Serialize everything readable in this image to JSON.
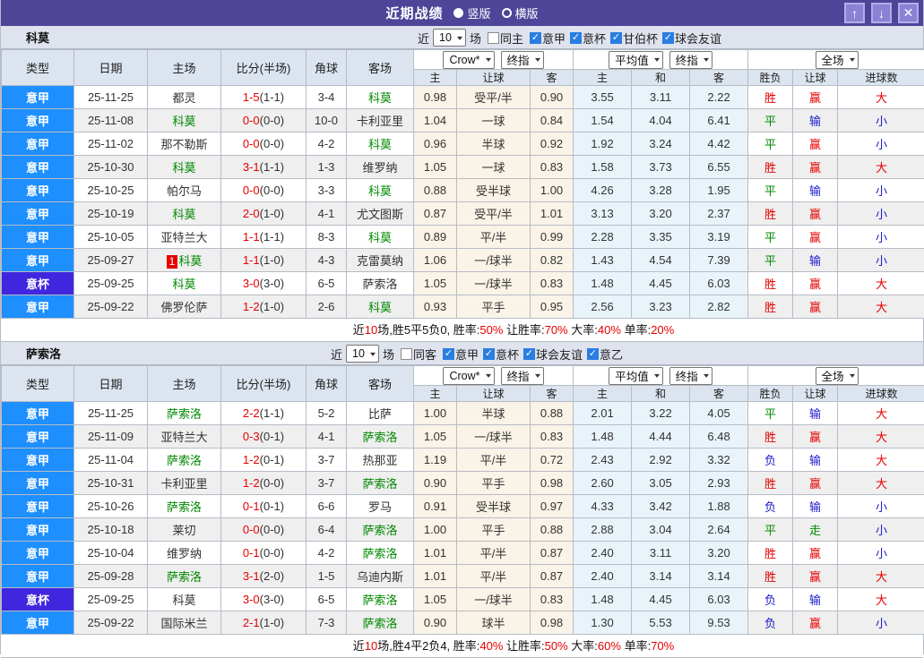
{
  "titlebar": {
    "title": "近期战绩",
    "radios": [
      {
        "label": "竖版",
        "selected": "true"
      },
      {
        "label": "横版",
        "selected": "false"
      }
    ],
    "up_icon": "↑",
    "down_icon": "↓",
    "close_icon": "✕"
  },
  "table_labels": {
    "type": "类型",
    "date": "日期",
    "home": "主场",
    "score": "比分(半场)",
    "corner": "角球",
    "away": "客场",
    "ah_home": "主",
    "ah_line": "让球",
    "ah_away": "客",
    "eu_home": "主",
    "eu_draw": "和",
    "eu_away": "客",
    "result": "胜负",
    "r_handicap": "让球",
    "r_goals": "进球数"
  },
  "dropdowns": {
    "bookmaker": "Crow*",
    "final1": "终指",
    "average": "平均值",
    "final2": "终指",
    "scope": "全场"
  },
  "colors": {
    "league_blue": "#1e8fff",
    "cup_purple": "#4126df",
    "win_red": "#e60000",
    "draw_green": "#008800",
    "lose_blue": "#1a1acd",
    "title_bg": "#4e4599",
    "focus_team_green": "#008800",
    "checkbox_blue": "#2a7de1"
  },
  "sections": [
    {
      "team": "科莫",
      "filters": {
        "near": "近",
        "count": "10",
        "games": "场",
        "same": "同主",
        "leagues": [
          "意甲",
          "意杯",
          "甘伯杯",
          "球会友谊"
        ]
      },
      "rows": [
        {
          "lg": {
            "t": "意甲",
            "c": "jia"
          },
          "date": "25-11-25",
          "hm": {
            "n": "都灵",
            "f": "false",
            "bd": ""
          },
          "sc": {
            "m": "1-5",
            "h": "(1-1)"
          },
          "cr": "3-4",
          "aw": {
            "n": "科莫",
            "f": "true"
          },
          "ah": [
            "0.98",
            "受平/半",
            "0.90"
          ],
          "eu": [
            "3.55",
            "3.11",
            "2.22"
          ],
          "rs": [
            {
              "t": "胜",
              "c": "r"
            },
            {
              "t": "赢",
              "c": "r"
            },
            {
              "t": "大",
              "c": "r"
            }
          ]
        },
        {
          "lg": {
            "t": "意甲",
            "c": "jia"
          },
          "date": "25-11-08",
          "hm": {
            "n": "科莫",
            "f": "true",
            "bd": ""
          },
          "sc": {
            "m": "0-0",
            "h": "(0-0)"
          },
          "cr": "10-0",
          "aw": {
            "n": "卡利亚里",
            "f": "false"
          },
          "ah": [
            "1.04",
            "一球",
            "0.84"
          ],
          "eu": [
            "1.54",
            "4.04",
            "6.41"
          ],
          "rs": [
            {
              "t": "平",
              "c": "g"
            },
            {
              "t": "输",
              "c": "b"
            },
            {
              "t": "小",
              "c": "b"
            }
          ]
        },
        {
          "lg": {
            "t": "意甲",
            "c": "jia"
          },
          "date": "25-11-02",
          "hm": {
            "n": "那不勒斯",
            "f": "false",
            "bd": ""
          },
          "sc": {
            "m": "0-0",
            "h": "(0-0)"
          },
          "cr": "4-2",
          "aw": {
            "n": "科莫",
            "f": "true"
          },
          "ah": [
            "0.96",
            "半球",
            "0.92"
          ],
          "eu": [
            "1.92",
            "3.24",
            "4.42"
          ],
          "rs": [
            {
              "t": "平",
              "c": "g"
            },
            {
              "t": "赢",
              "c": "r"
            },
            {
              "t": "小",
              "c": "b"
            }
          ]
        },
        {
          "lg": {
            "t": "意甲",
            "c": "jia"
          },
          "date": "25-10-30",
          "hm": {
            "n": "科莫",
            "f": "true",
            "bd": ""
          },
          "sc": {
            "m": "3-1",
            "h": "(1-1)"
          },
          "cr": "1-3",
          "aw": {
            "n": "维罗纳",
            "f": "false"
          },
          "ah": [
            "1.05",
            "一球",
            "0.83"
          ],
          "eu": [
            "1.58",
            "3.73",
            "6.55"
          ],
          "rs": [
            {
              "t": "胜",
              "c": "r"
            },
            {
              "t": "赢",
              "c": "r"
            },
            {
              "t": "大",
              "c": "r"
            }
          ]
        },
        {
          "lg": {
            "t": "意甲",
            "c": "jia"
          },
          "date": "25-10-25",
          "hm": {
            "n": "帕尔马",
            "f": "false",
            "bd": ""
          },
          "sc": {
            "m": "0-0",
            "h": "(0-0)"
          },
          "cr": "3-3",
          "aw": {
            "n": "科莫",
            "f": "true"
          },
          "ah": [
            "0.88",
            "受半球",
            "1.00"
          ],
          "eu": [
            "4.26",
            "3.28",
            "1.95"
          ],
          "rs": [
            {
              "t": "平",
              "c": "g"
            },
            {
              "t": "输",
              "c": "b"
            },
            {
              "t": "小",
              "c": "b"
            }
          ]
        },
        {
          "lg": {
            "t": "意甲",
            "c": "jia"
          },
          "date": "25-10-19",
          "hm": {
            "n": "科莫",
            "f": "true",
            "bd": ""
          },
          "sc": {
            "m": "2-0",
            "h": "(1-0)"
          },
          "cr": "4-1",
          "aw": {
            "n": "尤文图斯",
            "f": "false"
          },
          "ah": [
            "0.87",
            "受平/半",
            "1.01"
          ],
          "eu": [
            "3.13",
            "3.20",
            "2.37"
          ],
          "rs": [
            {
              "t": "胜",
              "c": "r"
            },
            {
              "t": "赢",
              "c": "r"
            },
            {
              "t": "小",
              "c": "b"
            }
          ]
        },
        {
          "lg": {
            "t": "意甲",
            "c": "jia"
          },
          "date": "25-10-05",
          "hm": {
            "n": "亚特兰大",
            "f": "false",
            "bd": ""
          },
          "sc": {
            "m": "1-1",
            "h": "(1-1)"
          },
          "cr": "8-3",
          "aw": {
            "n": "科莫",
            "f": "true"
          },
          "ah": [
            "0.89",
            "平/半",
            "0.99"
          ],
          "eu": [
            "2.28",
            "3.35",
            "3.19"
          ],
          "rs": [
            {
              "t": "平",
              "c": "g"
            },
            {
              "t": "赢",
              "c": "r"
            },
            {
              "t": "小",
              "c": "b"
            }
          ]
        },
        {
          "lg": {
            "t": "意甲",
            "c": "jia"
          },
          "date": "25-09-27",
          "hm": {
            "n": "科莫",
            "f": "true",
            "bd": "1"
          },
          "sc": {
            "m": "1-1",
            "h": "(1-0)"
          },
          "cr": "4-3",
          "aw": {
            "n": "克雷莫纳",
            "f": "false"
          },
          "ah": [
            "1.06",
            "一/球半",
            "0.82"
          ],
          "eu": [
            "1.43",
            "4.54",
            "7.39"
          ],
          "rs": [
            {
              "t": "平",
              "c": "g"
            },
            {
              "t": "输",
              "c": "b"
            },
            {
              "t": "小",
              "c": "b"
            }
          ]
        },
        {
          "lg": {
            "t": "意杯",
            "c": "bei"
          },
          "date": "25-09-25",
          "hm": {
            "n": "科莫",
            "f": "true",
            "bd": ""
          },
          "sc": {
            "m": "3-0",
            "h": "(3-0)"
          },
          "cr": "6-5",
          "aw": {
            "n": "萨索洛",
            "f": "false"
          },
          "ah": [
            "1.05",
            "一/球半",
            "0.83"
          ],
          "eu": [
            "1.48",
            "4.45",
            "6.03"
          ],
          "rs": [
            {
              "t": "胜",
              "c": "r"
            },
            {
              "t": "赢",
              "c": "r"
            },
            {
              "t": "大",
              "c": "r"
            }
          ]
        },
        {
          "lg": {
            "t": "意甲",
            "c": "jia"
          },
          "date": "25-09-22",
          "hm": {
            "n": "佛罗伦萨",
            "f": "false",
            "bd": ""
          },
          "sc": {
            "m": "1-2",
            "h": "(1-0)"
          },
          "cr": "2-6",
          "aw": {
            "n": "科莫",
            "f": "true"
          },
          "ah": [
            "0.93",
            "平手",
            "0.95"
          ],
          "eu": [
            "2.56",
            "3.23",
            "2.82"
          ],
          "rs": [
            {
              "t": "胜",
              "c": "r"
            },
            {
              "t": "赢",
              "c": "r"
            },
            {
              "t": "大",
              "c": "r"
            }
          ]
        }
      ],
      "summary": [
        {
          "t": "近",
          "c": "k"
        },
        {
          "t": "10",
          "c": "r"
        },
        {
          "t": "场,胜5平5负0, 胜率:",
          "c": "k"
        },
        {
          "t": "50%",
          "c": "r"
        },
        {
          "t": " 让胜率:",
          "c": "k"
        },
        {
          "t": "70%",
          "c": "r"
        },
        {
          "t": " 大率:",
          "c": "k"
        },
        {
          "t": "40%",
          "c": "r"
        },
        {
          "t": " 单率:",
          "c": "k"
        },
        {
          "t": "20%",
          "c": "r"
        }
      ]
    },
    {
      "team": "萨索洛",
      "filters": {
        "near": "近",
        "count": "10",
        "games": "场",
        "same": "同客",
        "leagues": [
          "意甲",
          "意杯",
          "球会友谊",
          "意乙"
        ]
      },
      "rows": [
        {
          "lg": {
            "t": "意甲",
            "c": "jia"
          },
          "date": "25-11-25",
          "hm": {
            "n": "萨索洛",
            "f": "true",
            "bd": ""
          },
          "sc": {
            "m": "2-2",
            "h": "(1-1)"
          },
          "cr": "5-2",
          "aw": {
            "n": "比萨",
            "f": "false"
          },
          "ah": [
            "1.00",
            "半球",
            "0.88"
          ],
          "eu": [
            "2.01",
            "3.22",
            "4.05"
          ],
          "rs": [
            {
              "t": "平",
              "c": "g"
            },
            {
              "t": "输",
              "c": "b"
            },
            {
              "t": "大",
              "c": "r"
            }
          ]
        },
        {
          "lg": {
            "t": "意甲",
            "c": "jia"
          },
          "date": "25-11-09",
          "hm": {
            "n": "亚特兰大",
            "f": "false",
            "bd": ""
          },
          "sc": {
            "m": "0-3",
            "h": "(0-1)"
          },
          "cr": "4-1",
          "aw": {
            "n": "萨索洛",
            "f": "true"
          },
          "ah": [
            "1.05",
            "一/球半",
            "0.83"
          ],
          "eu": [
            "1.48",
            "4.44",
            "6.48"
          ],
          "rs": [
            {
              "t": "胜",
              "c": "r"
            },
            {
              "t": "赢",
              "c": "r"
            },
            {
              "t": "大",
              "c": "r"
            }
          ]
        },
        {
          "lg": {
            "t": "意甲",
            "c": "jia"
          },
          "date": "25-11-04",
          "hm": {
            "n": "萨索洛",
            "f": "true",
            "bd": ""
          },
          "sc": {
            "m": "1-2",
            "h": "(0-1)"
          },
          "cr": "3-7",
          "aw": {
            "n": "热那亚",
            "f": "false"
          },
          "ah": [
            "1.19",
            "平/半",
            "0.72"
          ],
          "eu": [
            "2.43",
            "2.92",
            "3.32"
          ],
          "rs": [
            {
              "t": "负",
              "c": "b"
            },
            {
              "t": "输",
              "c": "b"
            },
            {
              "t": "大",
              "c": "r"
            }
          ]
        },
        {
          "lg": {
            "t": "意甲",
            "c": "jia"
          },
          "date": "25-10-31",
          "hm": {
            "n": "卡利亚里",
            "f": "false",
            "bd": ""
          },
          "sc": {
            "m": "1-2",
            "h": "(0-0)"
          },
          "cr": "3-7",
          "aw": {
            "n": "萨索洛",
            "f": "true"
          },
          "ah": [
            "0.90",
            "平手",
            "0.98"
          ],
          "eu": [
            "2.60",
            "3.05",
            "2.93"
          ],
          "rs": [
            {
              "t": "胜",
              "c": "r"
            },
            {
              "t": "赢",
              "c": "r"
            },
            {
              "t": "大",
              "c": "r"
            }
          ]
        },
        {
          "lg": {
            "t": "意甲",
            "c": "jia"
          },
          "date": "25-10-26",
          "hm": {
            "n": "萨索洛",
            "f": "true",
            "bd": ""
          },
          "sc": {
            "m": "0-1",
            "h": "(0-1)"
          },
          "cr": "6-6",
          "aw": {
            "n": "罗马",
            "f": "false"
          },
          "ah": [
            "0.91",
            "受半球",
            "0.97"
          ],
          "eu": [
            "4.33",
            "3.42",
            "1.88"
          ],
          "rs": [
            {
              "t": "负",
              "c": "b"
            },
            {
              "t": "输",
              "c": "b"
            },
            {
              "t": "小",
              "c": "b"
            }
          ]
        },
        {
          "lg": {
            "t": "意甲",
            "c": "jia"
          },
          "date": "25-10-18",
          "hm": {
            "n": "莱切",
            "f": "false",
            "bd": ""
          },
          "sc": {
            "m": "0-0",
            "h": "(0-0)"
          },
          "cr": "6-4",
          "aw": {
            "n": "萨索洛",
            "f": "true"
          },
          "ah": [
            "1.00",
            "平手",
            "0.88"
          ],
          "eu": [
            "2.88",
            "3.04",
            "2.64"
          ],
          "rs": [
            {
              "t": "平",
              "c": "g"
            },
            {
              "t": "走",
              "c": "g"
            },
            {
              "t": "小",
              "c": "b"
            }
          ]
        },
        {
          "lg": {
            "t": "意甲",
            "c": "jia"
          },
          "date": "25-10-04",
          "hm": {
            "n": "维罗纳",
            "f": "false",
            "bd": ""
          },
          "sc": {
            "m": "0-1",
            "h": "(0-0)"
          },
          "cr": "4-2",
          "aw": {
            "n": "萨索洛",
            "f": "true"
          },
          "ah": [
            "1.01",
            "平/半",
            "0.87"
          ],
          "eu": [
            "2.40",
            "3.11",
            "3.20"
          ],
          "rs": [
            {
              "t": "胜",
              "c": "r"
            },
            {
              "t": "赢",
              "c": "r"
            },
            {
              "t": "小",
              "c": "b"
            }
          ]
        },
        {
          "lg": {
            "t": "意甲",
            "c": "jia"
          },
          "date": "25-09-28",
          "hm": {
            "n": "萨索洛",
            "f": "true",
            "bd": ""
          },
          "sc": {
            "m": "3-1",
            "h": "(2-0)"
          },
          "cr": "1-5",
          "aw": {
            "n": "乌迪内斯",
            "f": "false"
          },
          "ah": [
            "1.01",
            "平/半",
            "0.87"
          ],
          "eu": [
            "2.40",
            "3.14",
            "3.14"
          ],
          "rs": [
            {
              "t": "胜",
              "c": "r"
            },
            {
              "t": "赢",
              "c": "r"
            },
            {
              "t": "大",
              "c": "r"
            }
          ]
        },
        {
          "lg": {
            "t": "意杯",
            "c": "bei"
          },
          "date": "25-09-25",
          "hm": {
            "n": "科莫",
            "f": "false",
            "bd": ""
          },
          "sc": {
            "m": "3-0",
            "h": "(3-0)"
          },
          "cr": "6-5",
          "aw": {
            "n": "萨索洛",
            "f": "true"
          },
          "ah": [
            "1.05",
            "一/球半",
            "0.83"
          ],
          "eu": [
            "1.48",
            "4.45",
            "6.03"
          ],
          "rs": [
            {
              "t": "负",
              "c": "b"
            },
            {
              "t": "输",
              "c": "b"
            },
            {
              "t": "大",
              "c": "r"
            }
          ]
        },
        {
          "lg": {
            "t": "意甲",
            "c": "jia"
          },
          "date": "25-09-22",
          "hm": {
            "n": "国际米兰",
            "f": "false",
            "bd": ""
          },
          "sc": {
            "m": "2-1",
            "h": "(1-0)"
          },
          "cr": "7-3",
          "aw": {
            "n": "萨索洛",
            "f": "true"
          },
          "ah": [
            "0.90",
            "球半",
            "0.98"
          ],
          "eu": [
            "1.30",
            "5.53",
            "9.53"
          ],
          "rs": [
            {
              "t": "负",
              "c": "b"
            },
            {
              "t": "赢",
              "c": "r"
            },
            {
              "t": "小",
              "c": "b"
            }
          ]
        }
      ],
      "summary": [
        {
          "t": "近",
          "c": "k"
        },
        {
          "t": "10",
          "c": "r"
        },
        {
          "t": "场,胜4平2负4, 胜率:",
          "c": "k"
        },
        {
          "t": "40%",
          "c": "r"
        },
        {
          "t": " 让胜率:",
          "c": "k"
        },
        {
          "t": "50%",
          "c": "r"
        },
        {
          "t": " 大率:",
          "c": "k"
        },
        {
          "t": "60%",
          "c": "r"
        },
        {
          "t": " 单率:",
          "c": "k"
        },
        {
          "t": "70%",
          "c": "r"
        }
      ]
    }
  ]
}
